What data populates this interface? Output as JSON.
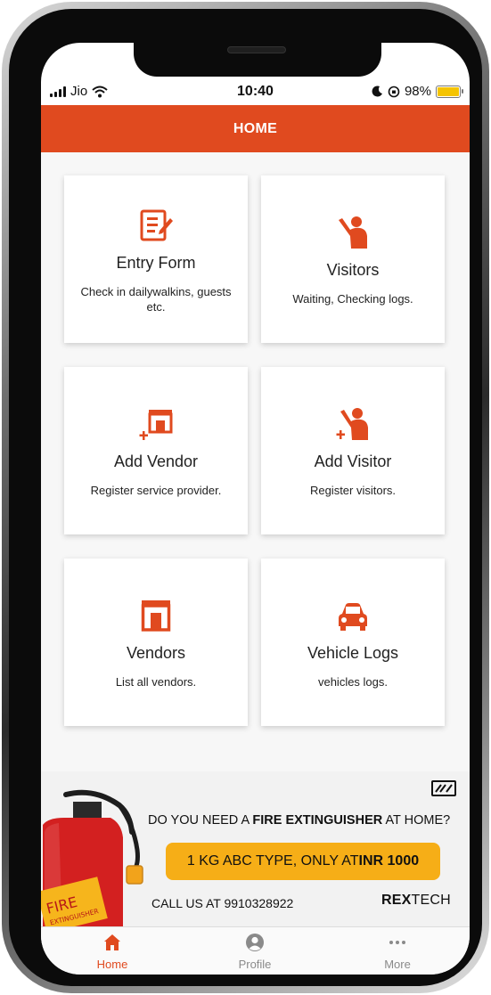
{
  "status_bar": {
    "carrier": "Jio",
    "time": "10:40",
    "battery_percent": "98%",
    "battery_level": 0.98
  },
  "header": {
    "title": "HOME"
  },
  "cards": [
    {
      "title": "Entry Form",
      "subtitle": "Check in dailywalkins, guests etc.",
      "icon": "entry-form-icon"
    },
    {
      "title": "Visitors",
      "subtitle": "Waiting, Checking logs.",
      "icon": "visitor-icon"
    },
    {
      "title": "Add Vendor",
      "subtitle": "Register service provider.",
      "icon": "add-vendor-icon"
    },
    {
      "title": "Add Visitor",
      "subtitle": "Register visitors.",
      "icon": "add-visitor-icon"
    },
    {
      "title": "Vendors",
      "subtitle": "List all vendors.",
      "icon": "vendor-store-icon"
    },
    {
      "title": "Vehicle Logs",
      "subtitle": "vehicles logs.",
      "icon": "car-icon"
    }
  ],
  "ad": {
    "question_prefix": "DO YOU NEED A ",
    "question_bold": "FIRE EXTINGUISHER",
    "question_suffix": " AT HOME?",
    "cta_prefix": "1 KG ABC TYPE, ONLY AT ",
    "cta_bold": "INR 1000",
    "phone": "CALL US AT 9910328922",
    "brand_bold": "REX",
    "brand_rest": "TECH",
    "extinguisher_label_1": "FIRE",
    "extinguisher_label_2": "EXTINGUISHER"
  },
  "bottom_nav": [
    {
      "label": "Home",
      "icon": "home-icon",
      "active": true
    },
    {
      "label": "Profile",
      "icon": "profile-icon",
      "active": false
    },
    {
      "label": "More",
      "icon": "more-dots-icon",
      "active": false
    }
  ],
  "colors": {
    "accent": "#e04a1f",
    "cta": "#f6ae17",
    "battery": "#f5c400",
    "nav_active": "#e04a1f",
    "nav_inactive": "#8a8a8a"
  }
}
